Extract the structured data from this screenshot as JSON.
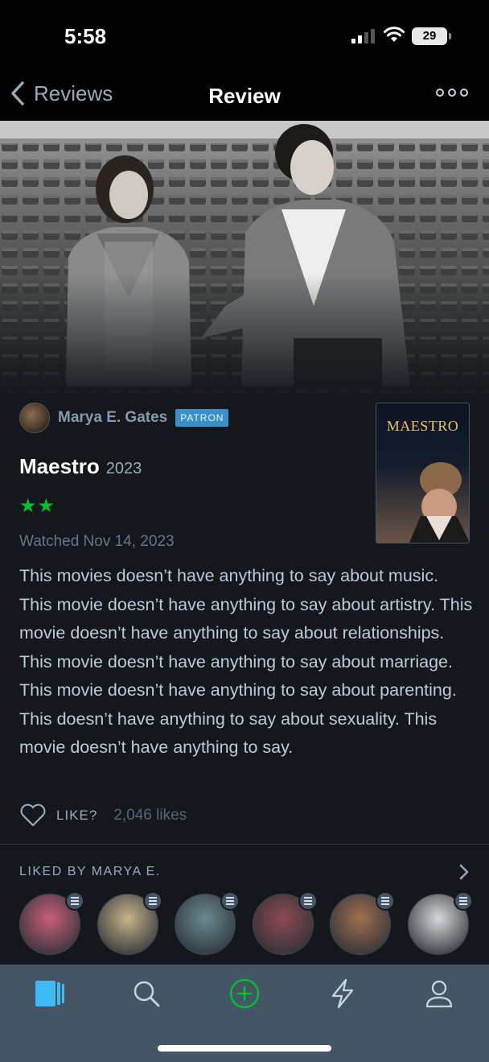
{
  "status_bar": {
    "time": "5:58",
    "battery": "29"
  },
  "nav": {
    "back_label": "Reviews",
    "title": "Review"
  },
  "review": {
    "author": "Marya E. Gates",
    "badge": "PATRON",
    "film_title": "Maestro",
    "film_year": "2023",
    "stars": "★★",
    "rating_value": 2,
    "watched": "Watched Nov 14, 2023",
    "poster_title": "MAESTRO",
    "text": "This movies doesn’t have anything to say about music. This movie doesn’t have anything to say about artistry. This movie doesn’t have anything to say about relationships. This movie doesn’t have anything to say about marriage. This movie doesn’t have anything to say about parenting. This doesn’t have anything to say about sexuality. This movie doesn’t have anything to say.",
    "like_label": "LIKE?",
    "like_count": "2,046 likes"
  },
  "liked_by": {
    "header": "LIKED BY MARYA E.",
    "avatars": [
      {
        "name": "liked-avatar-1",
        "color": "#c9607a"
      },
      {
        "name": "liked-avatar-2",
        "color": "#c7b48a"
      },
      {
        "name": "liked-avatar-3",
        "color": "#6c8a90"
      },
      {
        "name": "liked-avatar-4",
        "color": "#8e4a52"
      },
      {
        "name": "liked-avatar-5",
        "color": "#a07050"
      },
      {
        "name": "liked-avatar-6",
        "color": "#d8d8d8"
      }
    ]
  },
  "tab_bar": {
    "tabs": [
      "films-icon",
      "search-icon",
      "add-icon",
      "activity-icon",
      "profile-icon"
    ],
    "active": "films-icon",
    "colors": {
      "active": "#40bcf4",
      "add": "#00c030",
      "inactive": "#c8d4e0"
    }
  }
}
